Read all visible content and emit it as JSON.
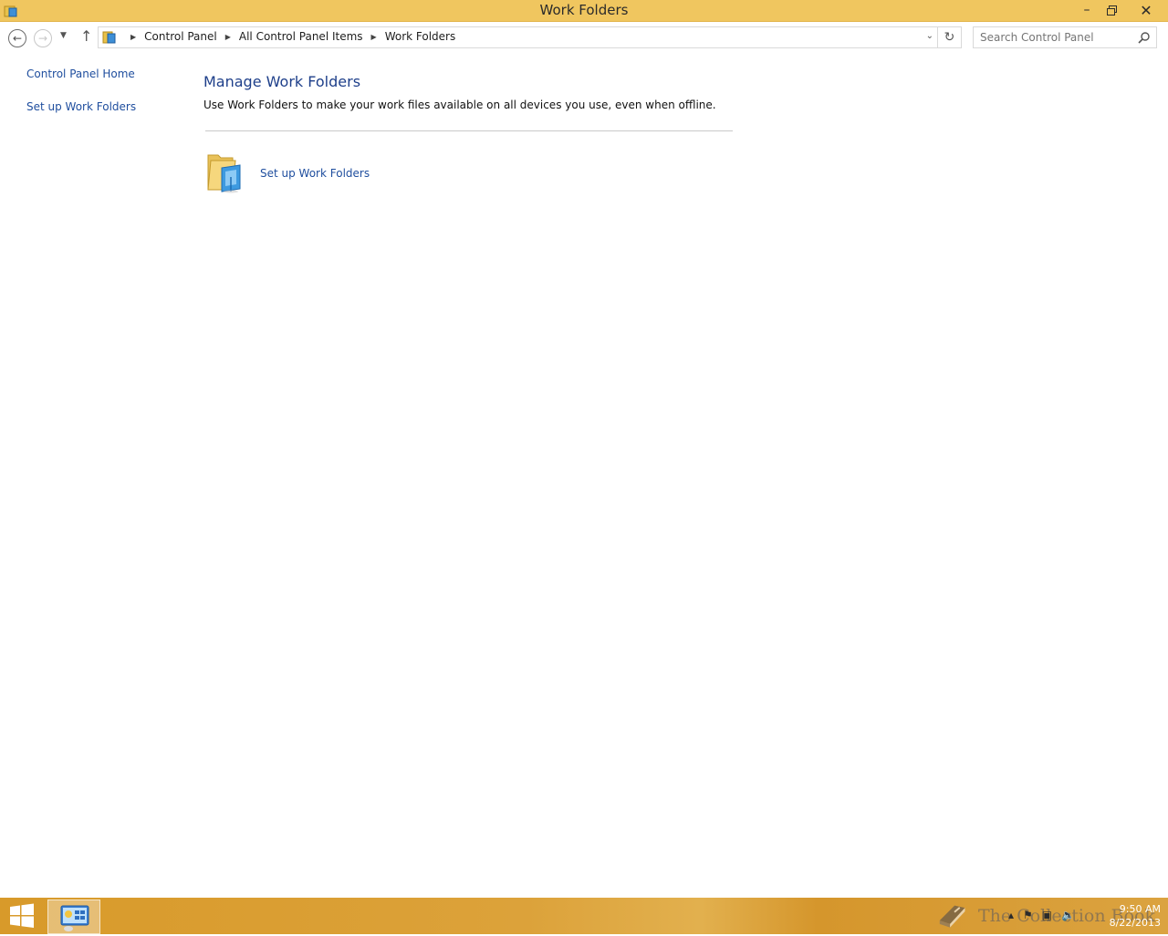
{
  "window": {
    "title": "Work Folders"
  },
  "toolbar": {
    "breadcrumbs": [
      "Control Panel",
      "All Control Panel Items",
      "Work Folders"
    ],
    "search_placeholder": "Search Control Panel"
  },
  "sidebar": {
    "items": [
      {
        "label": "Control Panel Home"
      },
      {
        "label": "Set up Work Folders"
      }
    ]
  },
  "main": {
    "title": "Manage Work Folders",
    "description": "Use Work Folders to make your work files available on all devices you use, even when offline.",
    "setup_link": "Set up Work Folders"
  },
  "taskbar": {
    "watermark": "The Collection Book",
    "clock_time": "9:50 AM",
    "clock_date": "8/22/2013"
  },
  "colors": {
    "titlebar": "#f0c65f",
    "link": "#1f4e9e",
    "heading": "#1e3f8a",
    "taskbar": "#d89a2a"
  },
  "icons": {
    "app": "work-folders-icon",
    "back": "back-arrow-icon",
    "forward": "forward-arrow-icon",
    "up": "up-arrow-icon",
    "refresh": "refresh-icon",
    "search": "search-icon",
    "start": "windows-logo-icon"
  }
}
